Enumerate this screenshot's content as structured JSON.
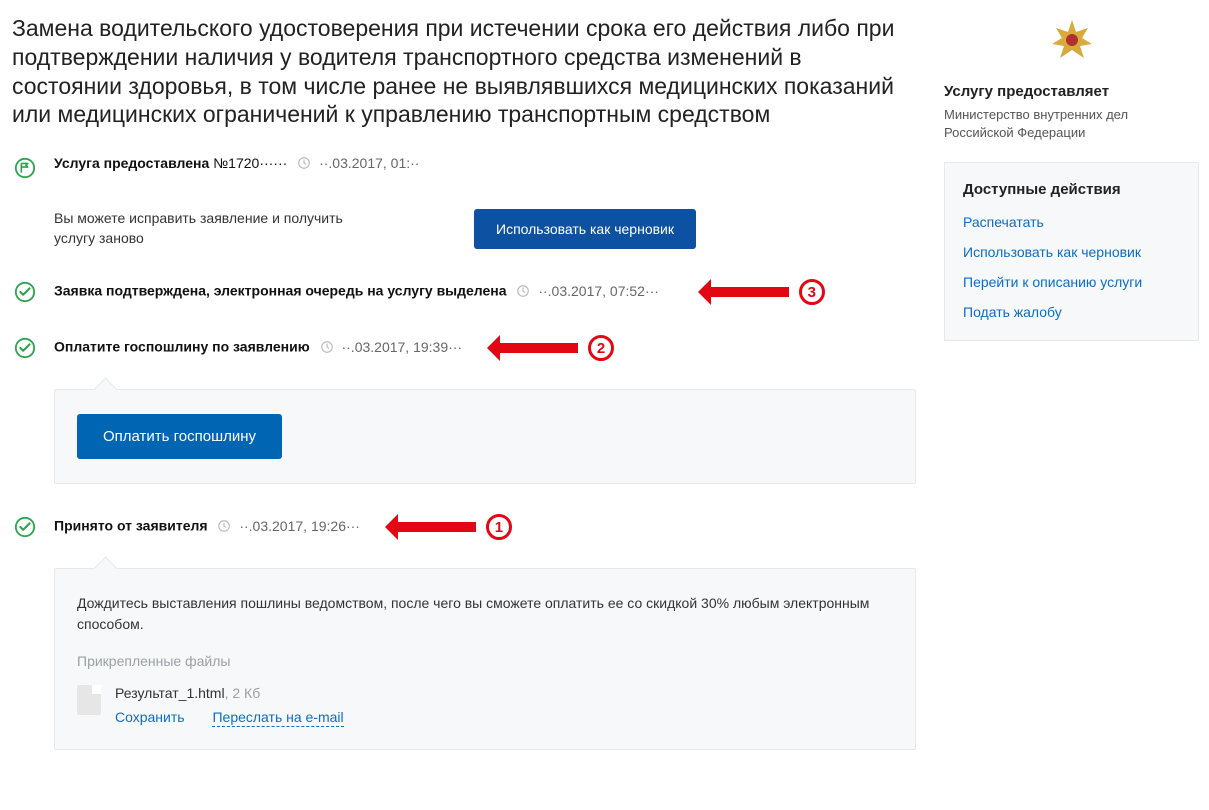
{
  "title": "Замена водительского удостоверения при истечении срока его действия либо при подтверждении наличия у водителя транспортного средства изменений в состоянии здоровья, в том числе ранее не выявлявшихся медицинских показаний или медицинских ограничений к управлению транспортным средством",
  "status_done": {
    "label": "Услуга предоставлена",
    "number": "№1720······",
    "time": "··.03.2017, 01:··"
  },
  "note": {
    "text": "Вы можете исправить заявление и получить услугу заново",
    "button": "Использовать как черновик"
  },
  "step_confirmed": {
    "label": "Заявка подтверждена, электронная очередь на услугу выделена",
    "time": "··.03.2017, 07:52···",
    "badge": "3"
  },
  "step_pay": {
    "label": "Оплатите госпошлину по заявлению",
    "time": "··.03.2017, 19:39···",
    "badge": "2",
    "button": "Оплатить госпошлину"
  },
  "step_received": {
    "label": "Принято от заявителя",
    "time": "··.03.2017, 19:26···",
    "badge": "1",
    "panel_text": "Дождитесь выставления пошлины ведомством, после чего вы сможете оплатить ее со скидкой 30% любым электронным способом.",
    "attach_label": "Прикрепленные файлы",
    "file": {
      "name": "Результат_1.html",
      "size": ", 2 Кб",
      "save": "Сохранить",
      "forward": "Переслать на e-mail"
    }
  },
  "sidebar": {
    "prov_title": "Услугу предоставляет",
    "prov_name": "Министерство внутренних дел Российской Федерации",
    "actions_title": "Доступные действия",
    "actions": [
      "Распечатать",
      "Использовать как черновик",
      "Перейти к описанию услуги",
      "Подать жалобу"
    ]
  }
}
